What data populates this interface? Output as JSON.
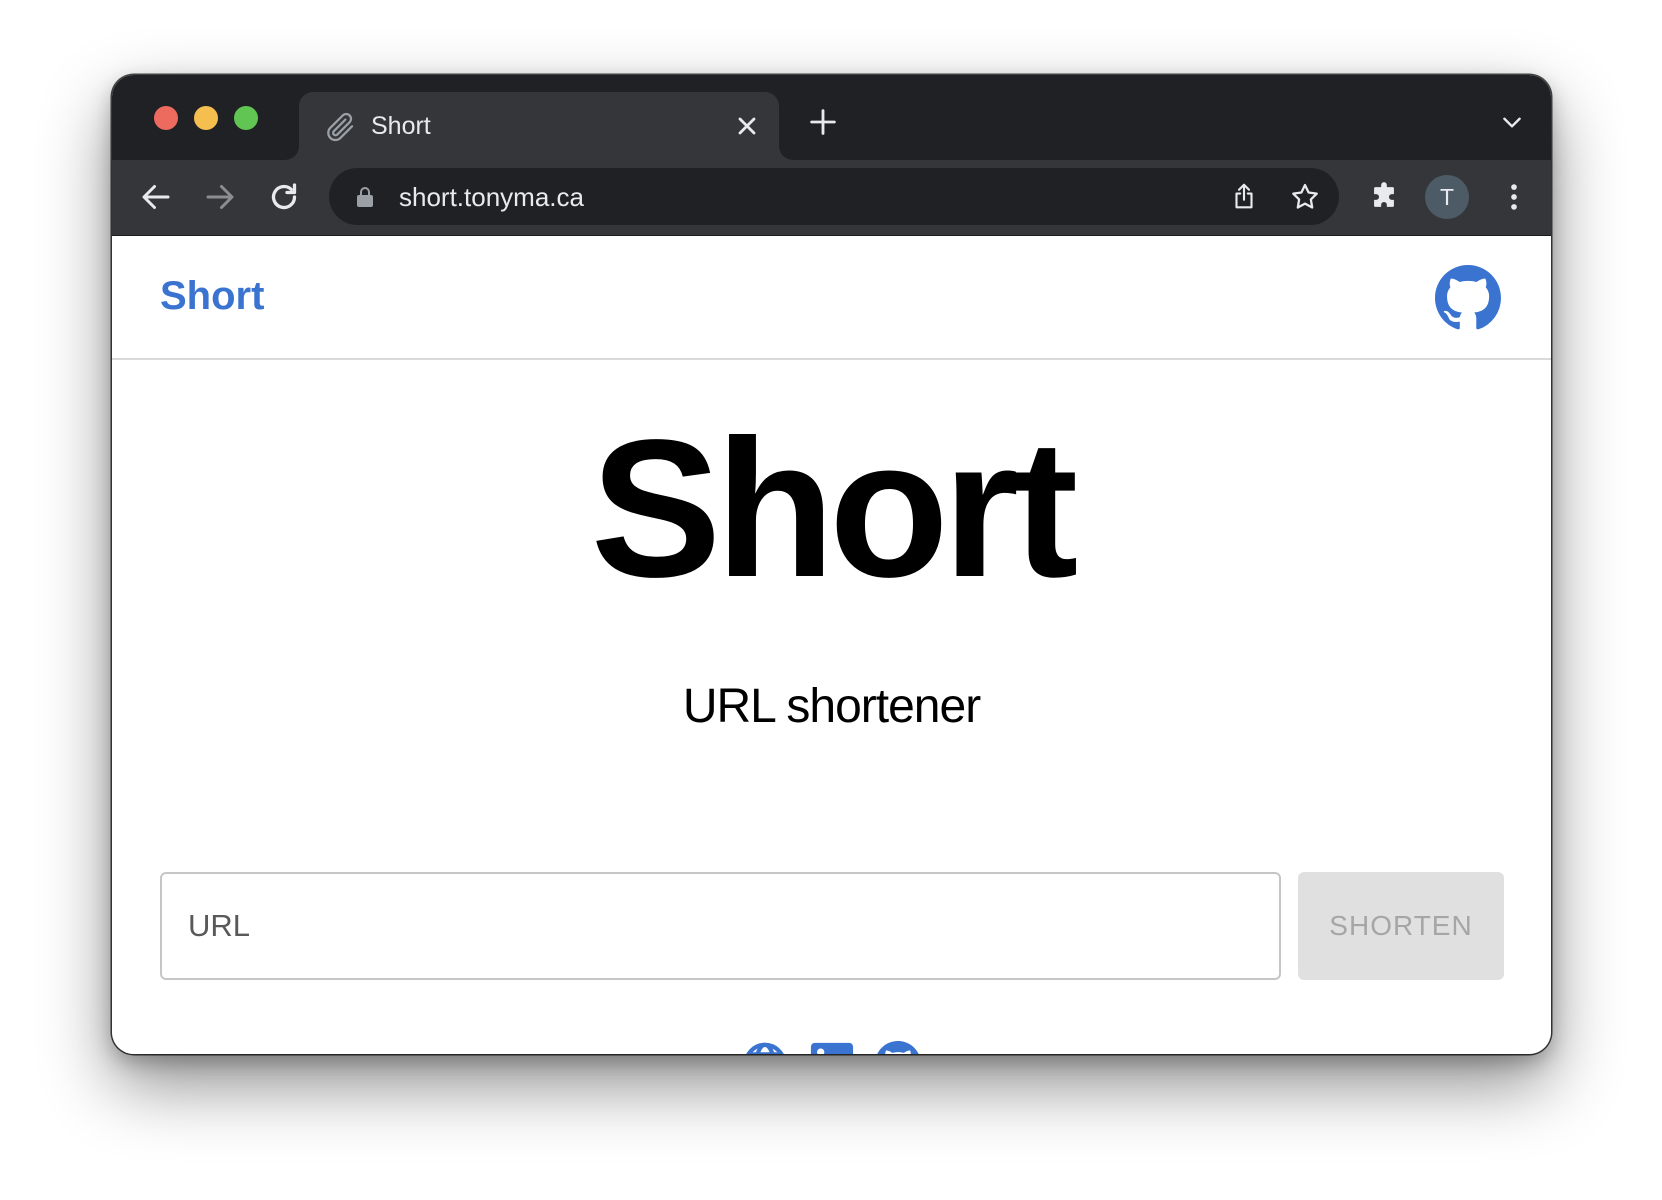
{
  "browser": {
    "tab": {
      "title": "Short",
      "icon": "paperclip-icon"
    },
    "toolbar": {
      "url": "short.tonyma.ca",
      "profile_initial": "T"
    }
  },
  "page": {
    "header": {
      "brand": "Short",
      "github_icon": "github-icon"
    },
    "hero": {
      "title": "Short",
      "subtitle": "URL shortener"
    },
    "form": {
      "url_placeholder": "URL",
      "url_value": "",
      "shorten_label": "SHORTEN"
    },
    "footer": {
      "links": [
        "globe-icon",
        "linkedin-icon",
        "github-icon"
      ]
    }
  },
  "colors": {
    "accent": "#3a74d0",
    "tabbar": "#202124",
    "toolbar": "#35363a",
    "button_disabled": "#e0e0e0"
  }
}
